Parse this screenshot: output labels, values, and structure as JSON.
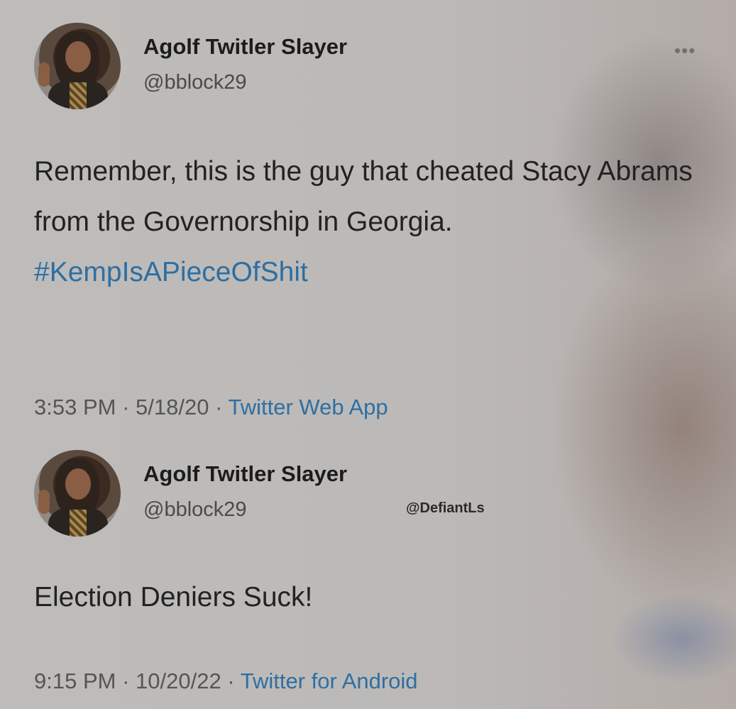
{
  "tweets": [
    {
      "display_name": "Agolf Twitler Slayer",
      "handle": "@bblock29",
      "more_label": "•••",
      "text": "Remember, this is the guy that cheated Stacy Abrams from the Governorship in Georgia.",
      "hashtag": "#KempIsAPieceOfShit",
      "time": "3:53 PM",
      "date": "5/18/20",
      "separator": "·",
      "source": "Twitter Web App"
    },
    {
      "display_name": "Agolf Twitler Slayer",
      "handle": "@bblock29",
      "text": "Election Deniers Suck!",
      "time": "9:15 PM",
      "date": "10/20/22",
      "separator": "·",
      "source": "Twitter for Android"
    }
  ],
  "watermark": "@DefiantLs",
  "colors": {
    "link": "#2d6fa3",
    "text": "#222222",
    "muted": "#555555"
  }
}
